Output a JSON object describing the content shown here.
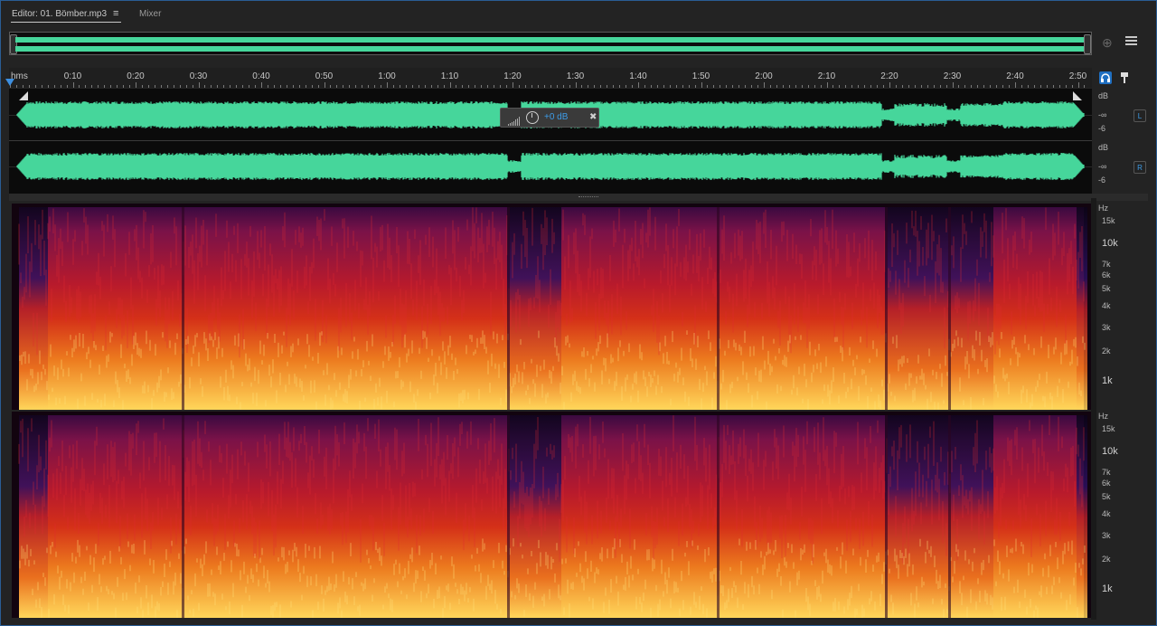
{
  "tabs": {
    "editor_label": "Editor: 01. Bömber.mp3",
    "menu_glyph": "≡",
    "mixer_label": "Mixer"
  },
  "colors": {
    "waveform": "#46d69b",
    "accent": "#3d8fe0",
    "spectral_low": "#12040f",
    "spectral_mid": "#c81e1e",
    "spectral_high": "#ffdc5a"
  },
  "ruler": {
    "unit": "hms",
    "labels": [
      "0:10",
      "0:20",
      "0:30",
      "0:40",
      "0:50",
      "1:00",
      "1:10",
      "1:20",
      "1:30",
      "1:40",
      "1:50",
      "2:00",
      "2:10",
      "2:20",
      "2:30",
      "2:40",
      "2:50"
    ]
  },
  "hud": {
    "value": "+0 dB",
    "pin_icon": "pin-icon",
    "knob_icon": "volume-knob-icon",
    "meter_icon": "level-meter-icon"
  },
  "amplitude_scale": {
    "unit": "dB",
    "neg_inf": "-∞",
    "minus6": "-6"
  },
  "channels": {
    "left": "L",
    "right": "R"
  },
  "frequency_scale": {
    "unit": "Hz",
    "labels": [
      "15k",
      "10k",
      "7k",
      "6k",
      "5k",
      "4k",
      "3k",
      "2k",
      "1k"
    ]
  },
  "icons": {
    "zoom": "zoom-navigator-icon",
    "list": "list-icon",
    "headphones": "headphones-icon",
    "marker": "marker-pin-icon"
  }
}
